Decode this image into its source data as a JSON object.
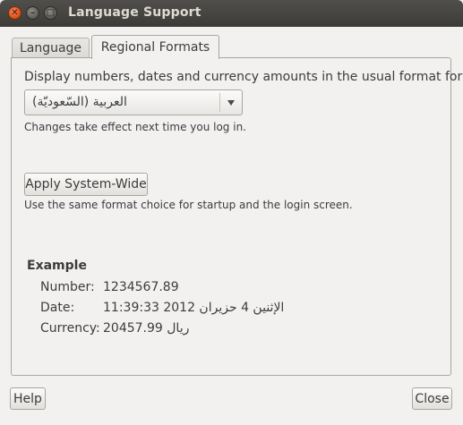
{
  "window": {
    "title": "Language Support",
    "close_icon": "close-icon",
    "minimize_icon": "minimize-icon",
    "maximize_icon": "maximize-icon"
  },
  "tabs": [
    {
      "label": "Language",
      "selected": false
    },
    {
      "label": "Regional Formats",
      "selected": true
    }
  ],
  "regional": {
    "description": "Display numbers, dates and currency amounts in the usual format for:",
    "format_selected": "العربية (السّعوديّة)",
    "change_note": "Changes take effect next time you log in.",
    "apply_button": "Apply System-Wide",
    "apply_note": "Use the same format choice for startup and the login screen."
  },
  "example": {
    "title": "Example",
    "rows": [
      {
        "label": "Number:",
        "value": "1234567.89"
      },
      {
        "label": "Date:",
        "value": "الإثنين  4 حزيران 2012 11:39:33"
      },
      {
        "label": "Currency:",
        "value": "ريال 20457.99"
      }
    ]
  },
  "footer": {
    "help_button": "Help",
    "close_button": "Close"
  }
}
